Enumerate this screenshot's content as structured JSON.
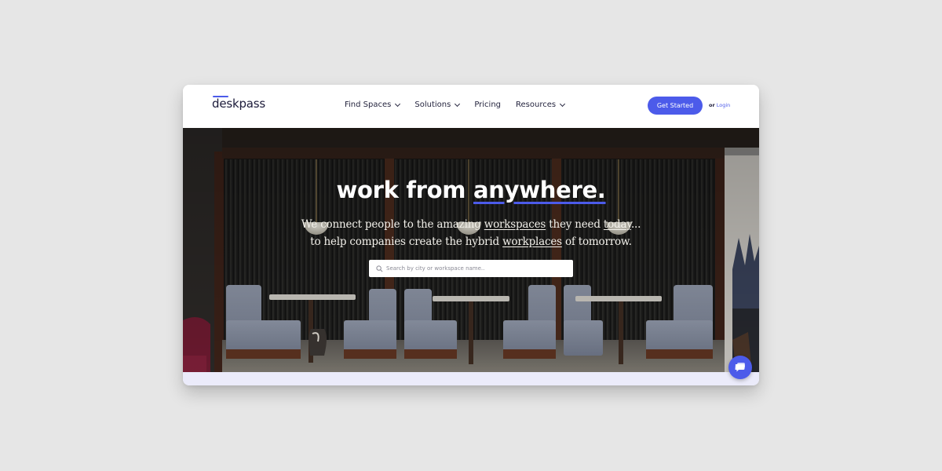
{
  "navbar": {
    "logo": "deskpass",
    "links": [
      {
        "label": "Find Spaces",
        "dropdown": true
      },
      {
        "label": "Solutions",
        "dropdown": true
      },
      {
        "label": "Pricing",
        "dropdown": false
      },
      {
        "label": "Resources",
        "dropdown": true
      }
    ],
    "cta_label": "Get Started",
    "login_prefix": "or",
    "login_label": "Login"
  },
  "hero": {
    "title_plain": "work from ",
    "title_accent": "anywhere.",
    "subtitle_line1": {
      "before": "We connect people to the amazing ",
      "link": "workspaces",
      "after_1": " they need ",
      "underlined": "today",
      "after_2": "..."
    },
    "subtitle_line2": {
      "before": "to help companies create the hybrid ",
      "link": "workplaces",
      "after": " of tomorrow."
    },
    "search_placeholder": "Search by city or workspace name..",
    "search_value": ""
  },
  "chat": {
    "icon": "chat-icon"
  },
  "colors": {
    "accent": "#4c5bea",
    "text_dark": "#1c1b3a",
    "page_bg": "#e6e6e6",
    "strip_bg": "#ebebfa"
  }
}
